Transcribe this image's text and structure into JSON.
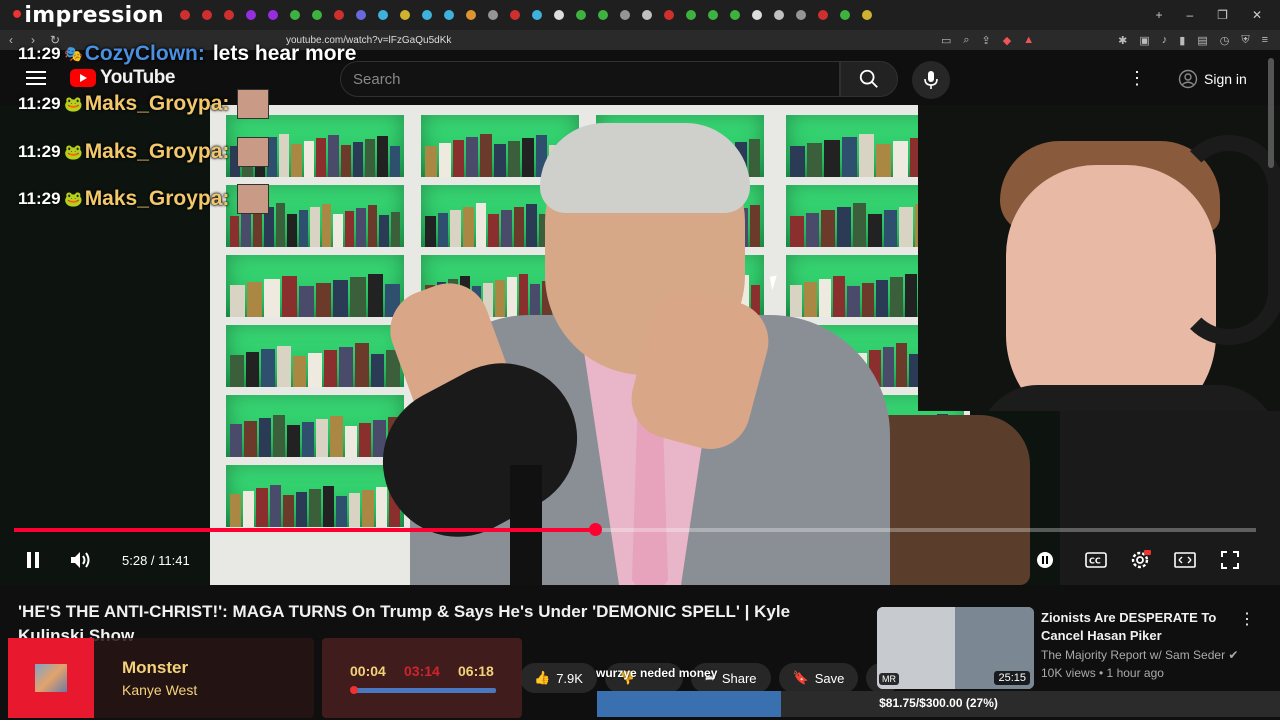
{
  "browser": {
    "brand_prefix": "",
    "brand_name": "impression",
    "url": "youtube.com/watch?v=lFzGaQu5dKk",
    "tab_favicon_colors": [
      "#e33",
      "#e33",
      "#e33",
      "#a3f",
      "#a3f",
      "#4c4",
      "#4c4",
      "#e33",
      "#77f",
      "#4cf",
      "#ec3",
      "#4cf",
      "#4cf",
      "#fa3",
      "#aaa",
      "#e33",
      "#4cf",
      "#fff",
      "#4c4",
      "#4c4",
      "#aaa",
      "#ddd",
      "#e33",
      "#4c4",
      "#4c4",
      "#4c4",
      "#fff",
      "#ddd",
      "#aaa",
      "#e33",
      "#4c4",
      "#ec3"
    ],
    "new_tab_label": "+",
    "min_label": "–",
    "max_label": "❐",
    "close_label": "✕"
  },
  "youtube": {
    "logo_text": "YouTube",
    "search_placeholder": "Search",
    "sign_in_label": "Sign in"
  },
  "chat": [
    {
      "time": "11:29",
      "badge": "🎭",
      "user": "CozyClown:",
      "user_color": "#4a90e2",
      "message": "lets hear more"
    },
    {
      "time": "11:29",
      "badge": "🐸",
      "user": "Maks_Groypa:",
      "user_color": "#f3c86a",
      "message": ""
    },
    {
      "time": "11:29",
      "badge": "🐸",
      "user": "Maks_Groypa:",
      "user_color": "#f3c86a",
      "message": ""
    },
    {
      "time": "11:29",
      "badge": "🐸",
      "user": "Maks_Groypa:",
      "user_color": "#f3c86a",
      "message": ""
    }
  ],
  "player": {
    "time_display": "5:28 / 11:41",
    "progress_fraction": 0.468
  },
  "video": {
    "title": "'HE'S THE ANTI-CHRIST!': MAGA TURNS On Trump & Says He's Under 'DEMONIC SPELL' | Kyle Kulinski Show",
    "like_count": "7.9K",
    "share_label": "Share",
    "save_label": "Save"
  },
  "recommended": {
    "title": "Zionists Are DESPERATE To Cancel Hasan Piker",
    "channel": "The Majority Report w/ Sam Seder",
    "meta": "10K views • 1 hour ago",
    "duration": "25:15",
    "badge": "MR"
  },
  "now_playing": {
    "song": "Monster",
    "artist": "Kanye West"
  },
  "song_timer": {
    "current": "00:04",
    "middle": "03:14",
    "total": "06:18"
  },
  "donation": {
    "text": "wurzye neded money",
    "goal_text": "$81.75/$300.00 (27%)",
    "goal_fraction": 0.27
  },
  "colors": {
    "accent": "#ff0033",
    "goal_fill": "#3a6fb0"
  }
}
